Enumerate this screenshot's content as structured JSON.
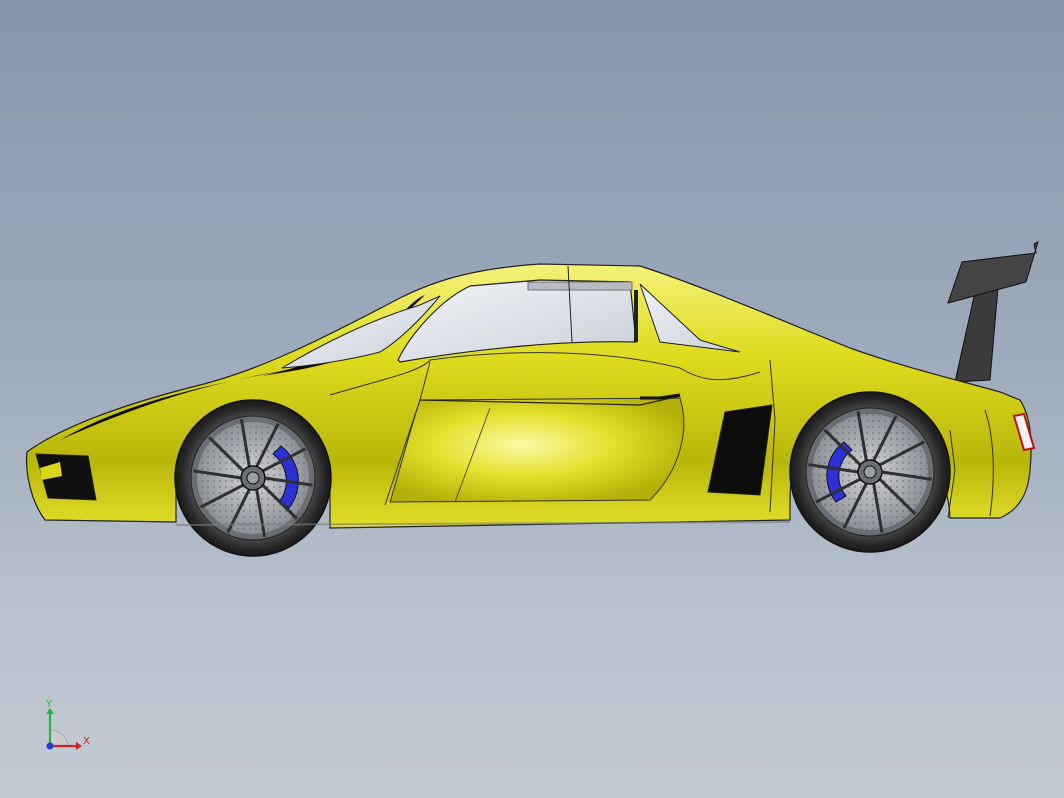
{
  "viewport": {
    "background_top": "#8696ab",
    "background_bottom": "#c3cad3"
  },
  "model": {
    "body_color": "#d9d61b",
    "body_highlight": "#f7f58a",
    "body_shadow": "#8a8a06",
    "glass_color": "#dfe4ea",
    "tire_color": "#2f2f2f",
    "rim_color": "#5a5d62",
    "brake_caliper_color": "#2c31d6",
    "trim_color": "#111111",
    "wing_color": "#3a3a3a"
  },
  "triad": {
    "x_label": "X",
    "y_label": "Y",
    "x_color": "#d81f1f",
    "y_color": "#1fb83a",
    "z_color": "#1f3ad8"
  }
}
